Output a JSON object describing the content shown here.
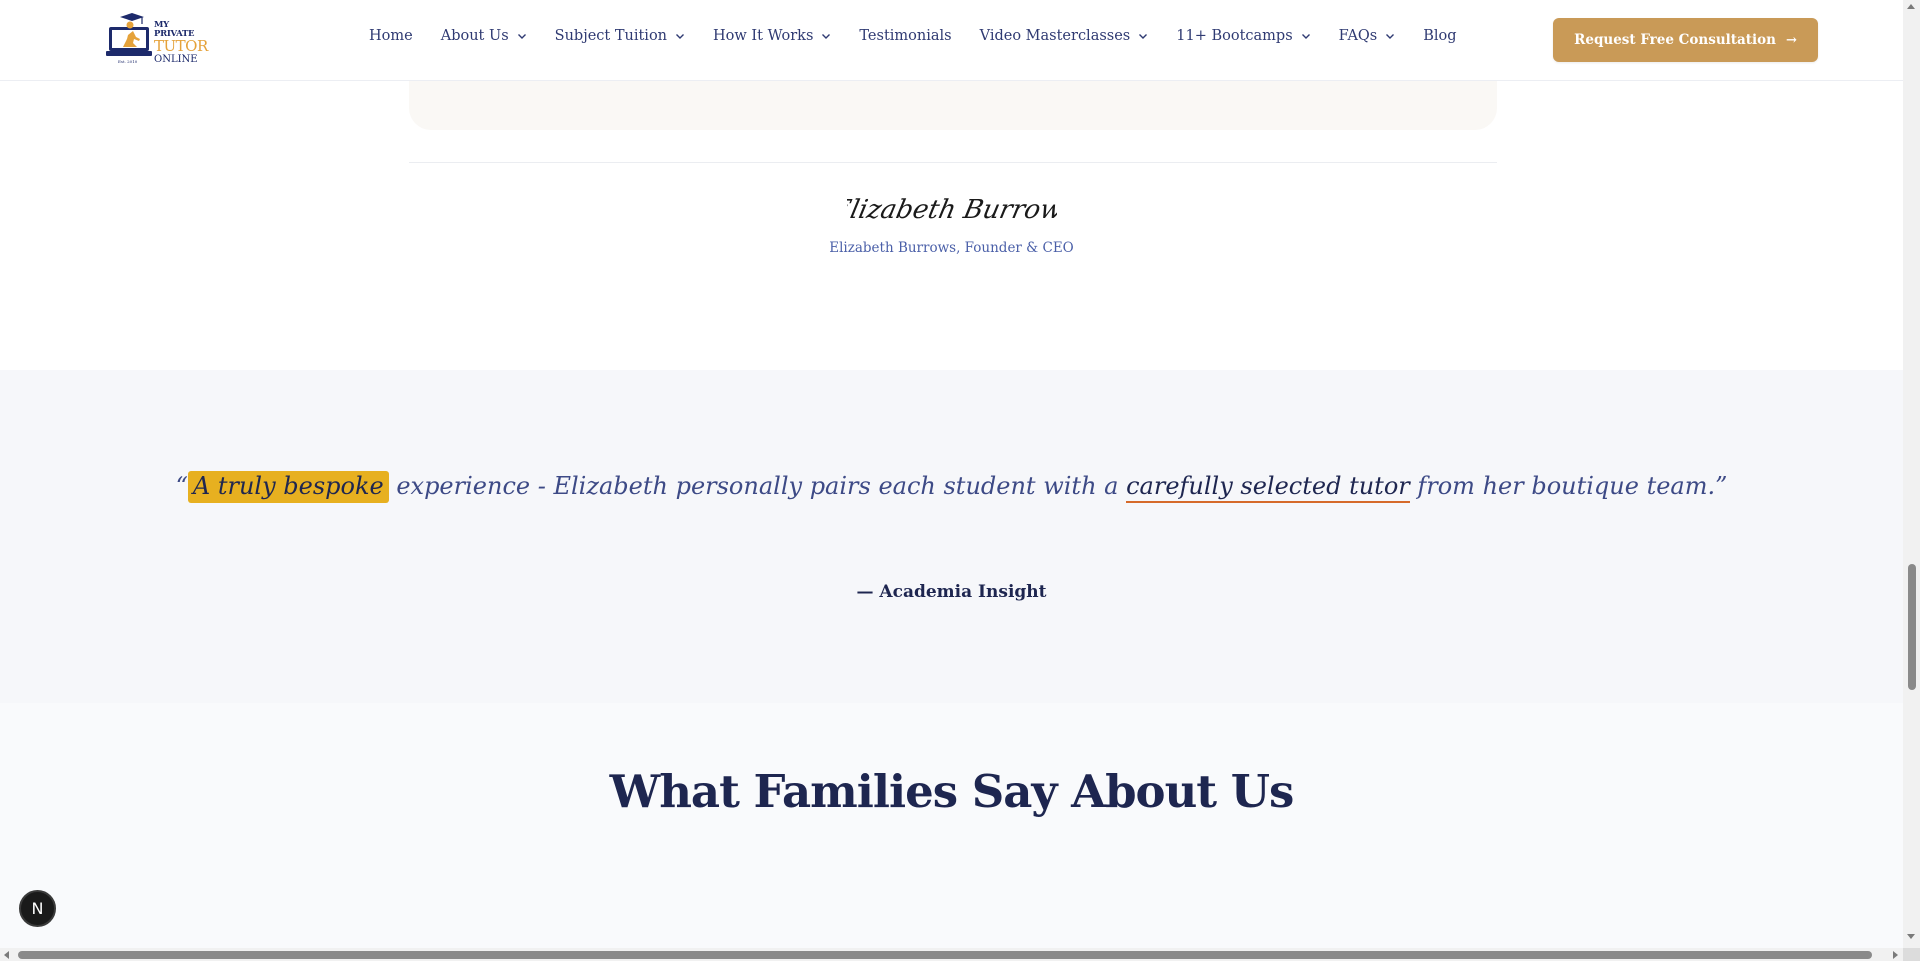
{
  "header": {
    "logo": {
      "line1": "MY PRIVATE",
      "line2": "TUTOR",
      "line3": "ONLINE",
      "est": "Est. 2010"
    },
    "nav": [
      {
        "label": "Home",
        "dropdown": false
      },
      {
        "label": "About Us",
        "dropdown": true
      },
      {
        "label": "Subject Tuition",
        "dropdown": true
      },
      {
        "label": "How It Works",
        "dropdown": true
      },
      {
        "label": "Testimonials",
        "dropdown": false
      },
      {
        "label": "Video Masterclasses",
        "dropdown": true
      },
      {
        "label": "11+ Bootcamps",
        "dropdown": true
      },
      {
        "label": "FAQs",
        "dropdown": true
      },
      {
        "label": "Blog",
        "dropdown": false
      }
    ],
    "cta_label": "Request Free Consultation",
    "cta_icon": "arrow-right-icon"
  },
  "signature": {
    "script_text": "Elizabeth Burrows",
    "caption": "Elizabeth Burrows, Founder & CEO"
  },
  "quote": {
    "open_mark": "“",
    "highlight": "A truly bespoke",
    "middle": " experience - Elizabeth personally pairs each student with a ",
    "underline": "carefully selected tutor",
    "end": " from her boutique team.",
    "close_mark": "”",
    "attribution": "— Academia Insight"
  },
  "testimonials": {
    "title": "What Families Say About Us"
  },
  "badge": {
    "label": "N"
  },
  "colors": {
    "brand_navy": "#1e2650",
    "brand_gold": "#c99a57",
    "highlight": "#e7b020",
    "underline": "#d66a2a"
  }
}
